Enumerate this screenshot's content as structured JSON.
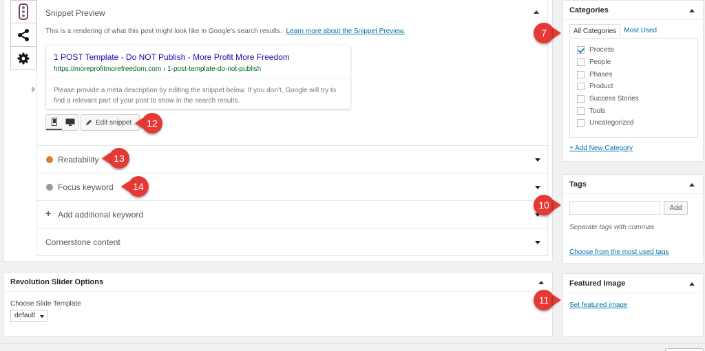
{
  "yoast": {
    "tabs": [
      {
        "icon": "traffic-light-icon"
      },
      {
        "icon": "share-icon"
      },
      {
        "icon": "gear-icon"
      }
    ],
    "snippet_preview": {
      "header": "Snippet Preview",
      "description": "This is a rendering of what this post might look like in Google's search results.",
      "learn_more": "Learn more about the Snippet Preview.",
      "serp_title": "1 POST Template - Do NOT Publish - More Profit More Freedom",
      "serp_url": "https://moreprofitmorefreedom.com › 1-post-template-do-not-publish",
      "serp_meta": "Please provide a meta description by editing the snippet below. If you don’t, Google will try to find a relevant part of your post to show in the search results.",
      "edit_snippet": "Edit snippet"
    },
    "sections": [
      {
        "label": "Readability",
        "dot_color": "#dc7b2a"
      },
      {
        "label": "Focus keyword",
        "dot_color": "#999999"
      },
      {
        "label": "Add additional keyword"
      },
      {
        "label": "Cornerstone content"
      }
    ]
  },
  "revolution_slider": {
    "title": "Revolution Slider Options",
    "field_label": "Choose Slide Template",
    "selected": "default"
  },
  "categories": {
    "title": "Categories",
    "tab_all": "All Categories",
    "tab_most_used": "Most Used",
    "items": [
      {
        "label": "Process",
        "checked": true
      },
      {
        "label": "People",
        "checked": false
      },
      {
        "label": "Phases",
        "checked": false
      },
      {
        "label": "Product",
        "checked": false
      },
      {
        "label": "Success Stories",
        "checked": false
      },
      {
        "label": "Tools",
        "checked": false
      },
      {
        "label": "Uncategorized",
        "checked": false
      }
    ],
    "add_new": "+ Add New Category"
  },
  "tags": {
    "title": "Tags",
    "input_value": "",
    "add_button": "Add",
    "hint": "Separate tags with commas",
    "choose": "Choose from the most used tags"
  },
  "featured_image": {
    "title": "Featured Image",
    "set_link": "Set featured image"
  },
  "markers": {
    "m7": "7",
    "m10": "10",
    "m11": "11",
    "m12": "12",
    "m13": "13",
    "m14": "14"
  },
  "colors": {
    "marker": "#e53935",
    "link": "#0073aa",
    "serp_title": "#1a0dab",
    "serp_url": "#006621"
  }
}
